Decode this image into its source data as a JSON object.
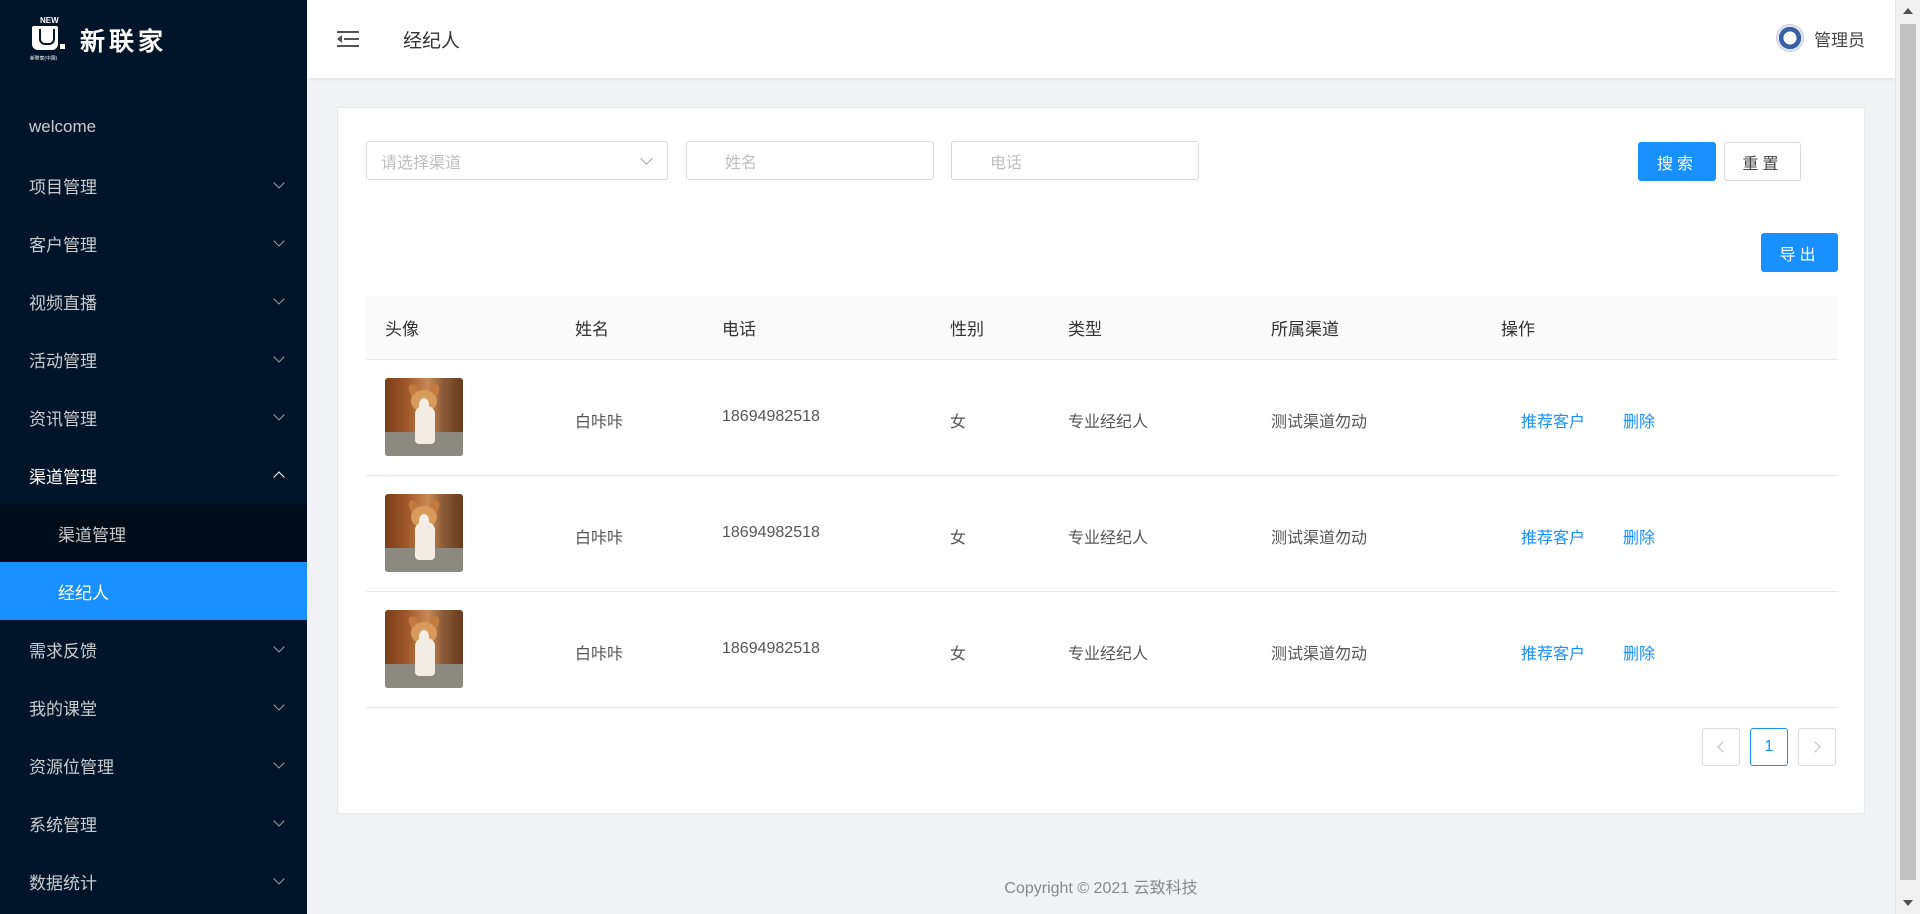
{
  "brand": {
    "logo_badge": "NEW",
    "logo_sub": "新联家(中国)",
    "name": "新联家"
  },
  "sidebar": {
    "items": [
      {
        "label": "welcome"
      },
      {
        "label": "项目管理"
      },
      {
        "label": "客户管理"
      },
      {
        "label": "视频直播"
      },
      {
        "label": "活动管理"
      },
      {
        "label": "资讯管理"
      },
      {
        "label": "渠道管理",
        "open": true,
        "children": [
          {
            "label": "渠道管理"
          },
          {
            "label": "经纪人",
            "active": true
          }
        ]
      },
      {
        "label": "需求反馈"
      },
      {
        "label": "我的课堂"
      },
      {
        "label": "资源位管理"
      },
      {
        "label": "系统管理"
      },
      {
        "label": "数据统计"
      }
    ]
  },
  "header": {
    "title": "经纪人",
    "user": "管理员"
  },
  "filters": {
    "channel_placeholder": "请选择渠道",
    "name_placeholder": "姓名",
    "phone_placeholder": "电话",
    "search_label": "搜索",
    "reset_label": "重置",
    "export_label": "导出"
  },
  "table": {
    "columns": [
      "头像",
      "姓名",
      "电话",
      "性别",
      "类型",
      "所属渠道",
      "操作"
    ],
    "rows": [
      {
        "name": "白咔咔",
        "phone": "18694982518",
        "gender": "女",
        "type": "专业经纪人",
        "channel": "测试渠道勿动",
        "action_recommend": "推荐客户",
        "action_delete": "删除"
      },
      {
        "name": "白咔咔",
        "phone": "18694982518",
        "gender": "女",
        "type": "专业经纪人",
        "channel": "测试渠道勿动",
        "action_recommend": "推荐客户",
        "action_delete": "删除"
      },
      {
        "name": "白咔咔",
        "phone": "18694982518",
        "gender": "女",
        "type": "专业经纪人",
        "channel": "测试渠道勿动",
        "action_recommend": "推荐客户",
        "action_delete": "删除"
      }
    ]
  },
  "pagination": {
    "current": "1"
  },
  "footer": {
    "copyright": "Copyright © 2021 云致科技"
  },
  "colors": {
    "primary": "#1890ff",
    "sidebar": "#001529",
    "submenu": "#000c17"
  }
}
